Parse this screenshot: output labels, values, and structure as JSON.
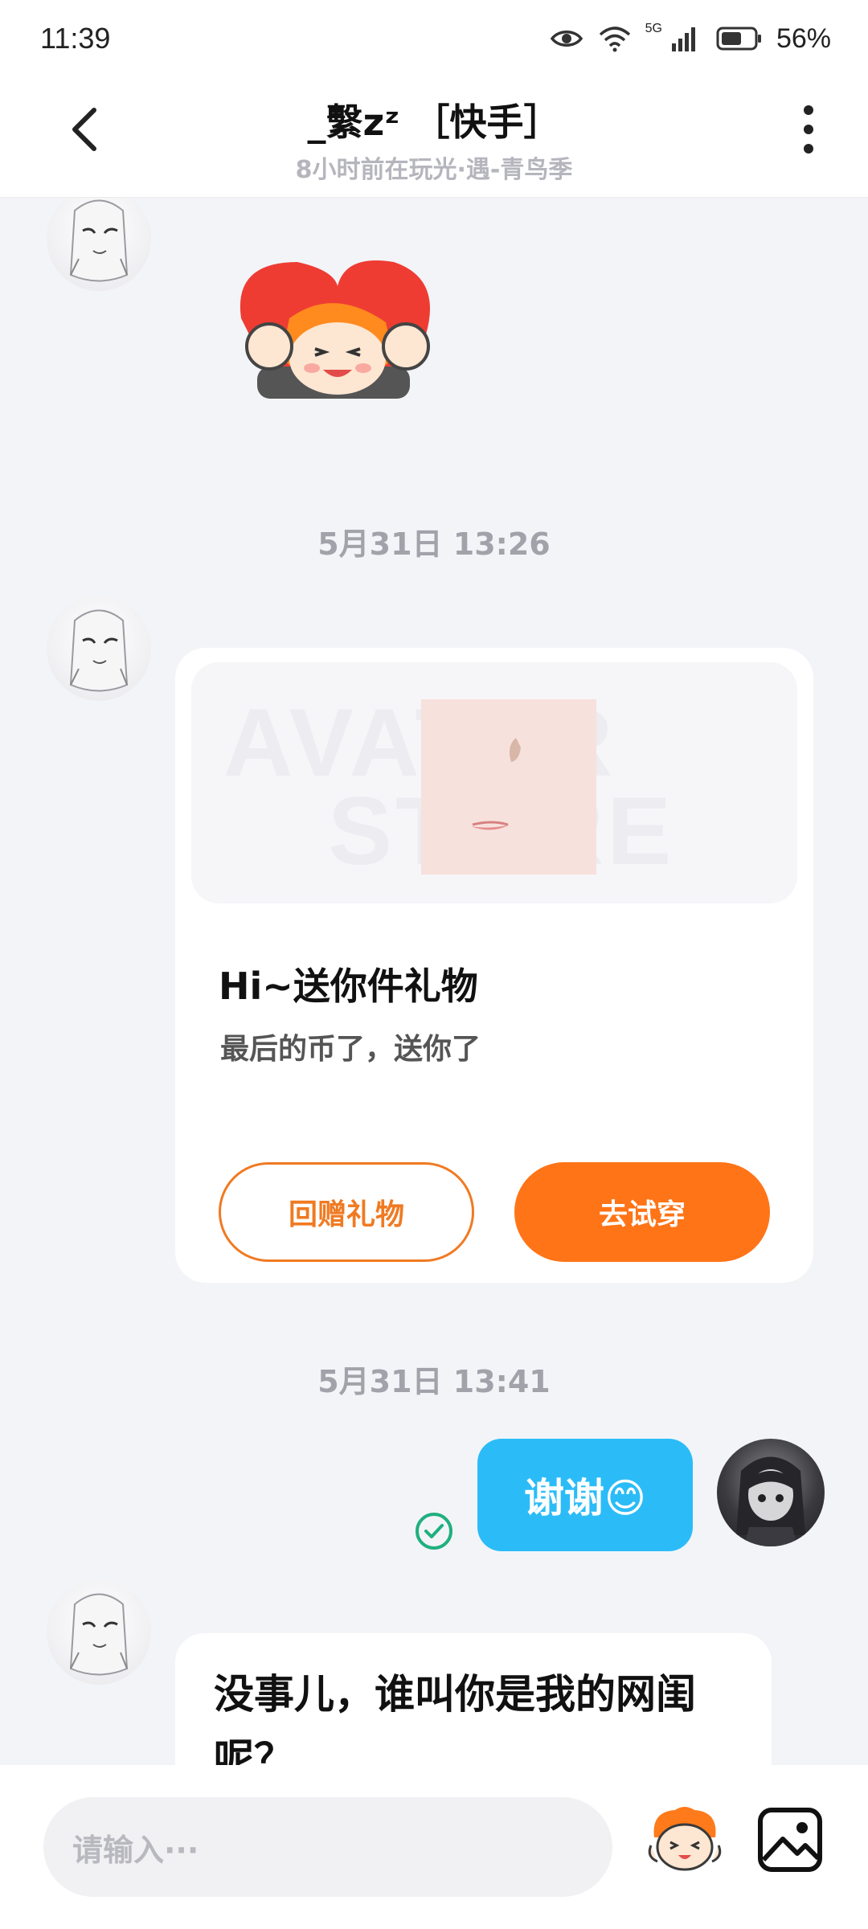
{
  "status_bar": {
    "time": "11:39",
    "network": "5G",
    "battery": "56%",
    "icons": [
      "eye-icon",
      "wifi-icon",
      "signal-icon",
      "battery-icon"
    ]
  },
  "header": {
    "title": "_繫zᶻ ［快手］",
    "subtitle": "8小时前在玩光·遇-青鸟季",
    "icons": [
      "back-arrow-icon",
      "more-vertical-icon"
    ]
  },
  "messages": {
    "time_1": "5月31日 13:26",
    "gift_card": {
      "watermark_line1": "AVATAR",
      "watermark_line2": "STORE",
      "title": "Hi~送你件礼物",
      "description": "最后的币了，送你了",
      "return_gift_label": "回赠礼物",
      "try_on_label": "去试穿"
    },
    "time_2": "5月31日 13:41",
    "my_message": "谢谢😊",
    "their_message": "没事儿，谁叫你是我的网闺呢？"
  },
  "input": {
    "placeholder": "请输入···"
  },
  "colors": {
    "accent_orange": "#ff7417",
    "bubble_blue": "#2bbcf7",
    "check_green": "#1fb07e",
    "background": "#f3f4f8"
  }
}
